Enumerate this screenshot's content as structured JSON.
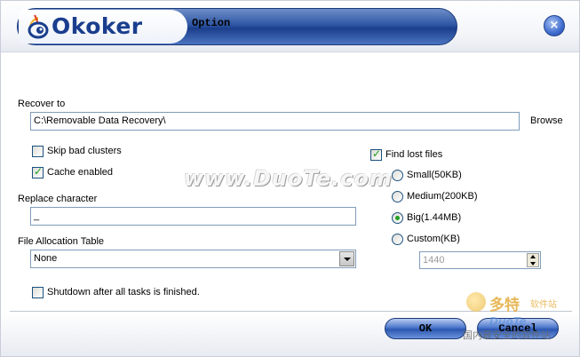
{
  "header": {
    "brand": "Okoker",
    "title": "Option",
    "close_symbol": "×"
  },
  "recover_to": {
    "label": "Recover to",
    "value": "C:\\Removable Data Recovery\\",
    "browse_label": "Browse"
  },
  "options": {
    "skip_bad_clusters": {
      "label": "Skip bad clusters",
      "checked": false
    },
    "cache_enabled": {
      "label": "Cache enabled",
      "checked": true
    },
    "find_lost_files": {
      "label": "Find lost files",
      "checked": true
    }
  },
  "replace_character": {
    "label": "Replace character",
    "value": "_"
  },
  "file_allocation_table": {
    "label": "File Allocation Table",
    "selected": "None"
  },
  "size_options": {
    "small": "Small(50KB)",
    "medium": "Medium(200KB)",
    "big": "Big(1.44MB)",
    "custom": "Custom(KB)",
    "selected": "big",
    "custom_value": "1440"
  },
  "shutdown": {
    "label": "Shutdown after all tasks is finished.",
    "checked": false
  },
  "buttons": {
    "ok": "OK",
    "cancel": "Cancel"
  },
  "watermark": {
    "main": "www.DuoTe.com",
    "corner_big": "多特",
    "corner_small": "软件站",
    "corner_duo": "DuoTe",
    "corner_cn": "国内最安全的软件站"
  },
  "colors": {
    "brand_blue": "#1a3e8e",
    "accent_blue": "#2e56a4",
    "check_green": "#21a121"
  },
  "icons": {
    "logo": "okoker-eye-icon",
    "close": "close-icon"
  }
}
